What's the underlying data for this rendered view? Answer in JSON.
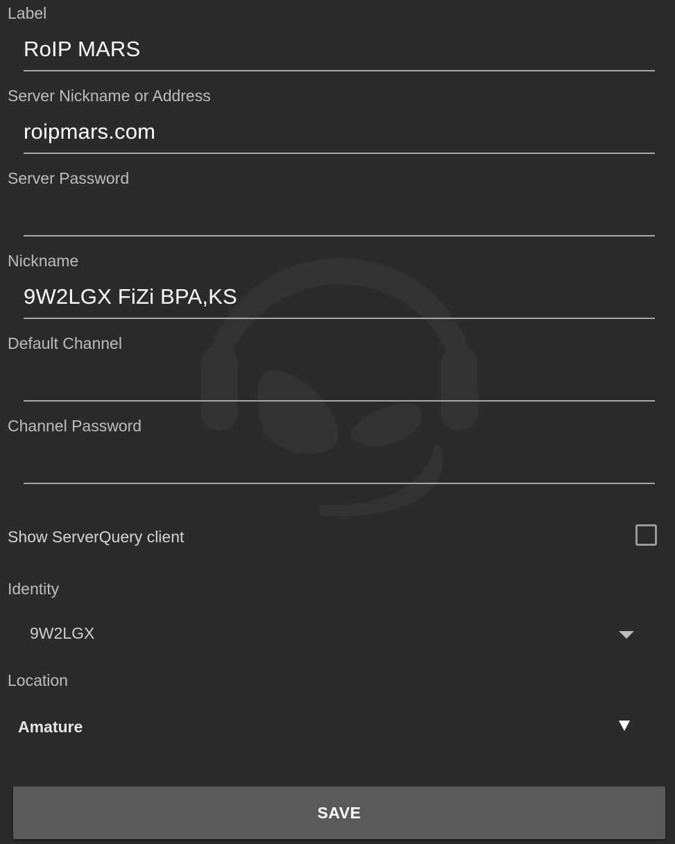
{
  "fields": [
    {
      "label": "Label",
      "value": "RoIP MARS"
    },
    {
      "label": "Server Nickname or Address",
      "value": "roipmars.com"
    },
    {
      "label": "Server Password",
      "value": ""
    },
    {
      "label": "Nickname",
      "value": "9W2LGX FiZi BPA,KS"
    },
    {
      "label": "Default Channel",
      "value": ""
    },
    {
      "label": "Channel Password",
      "value": ""
    }
  ],
  "serverquery": {
    "label": "Show ServerQuery client",
    "checked": false
  },
  "identity": {
    "label": "Identity",
    "selected": "9W2LGX"
  },
  "location": {
    "label": "Location",
    "selected": "Amature"
  },
  "save_button": {
    "label": "SAVE"
  },
  "colors": {
    "background": "#2b2b2b",
    "button": "#5a5a5b",
    "underline": "#a9a9a9",
    "watermark": "#333333"
  },
  "icons": {
    "watermark": "headset-logo-icon",
    "identity_dropdown": "triangle-down-icon",
    "location_dropdown": "triangle-down-icon"
  }
}
